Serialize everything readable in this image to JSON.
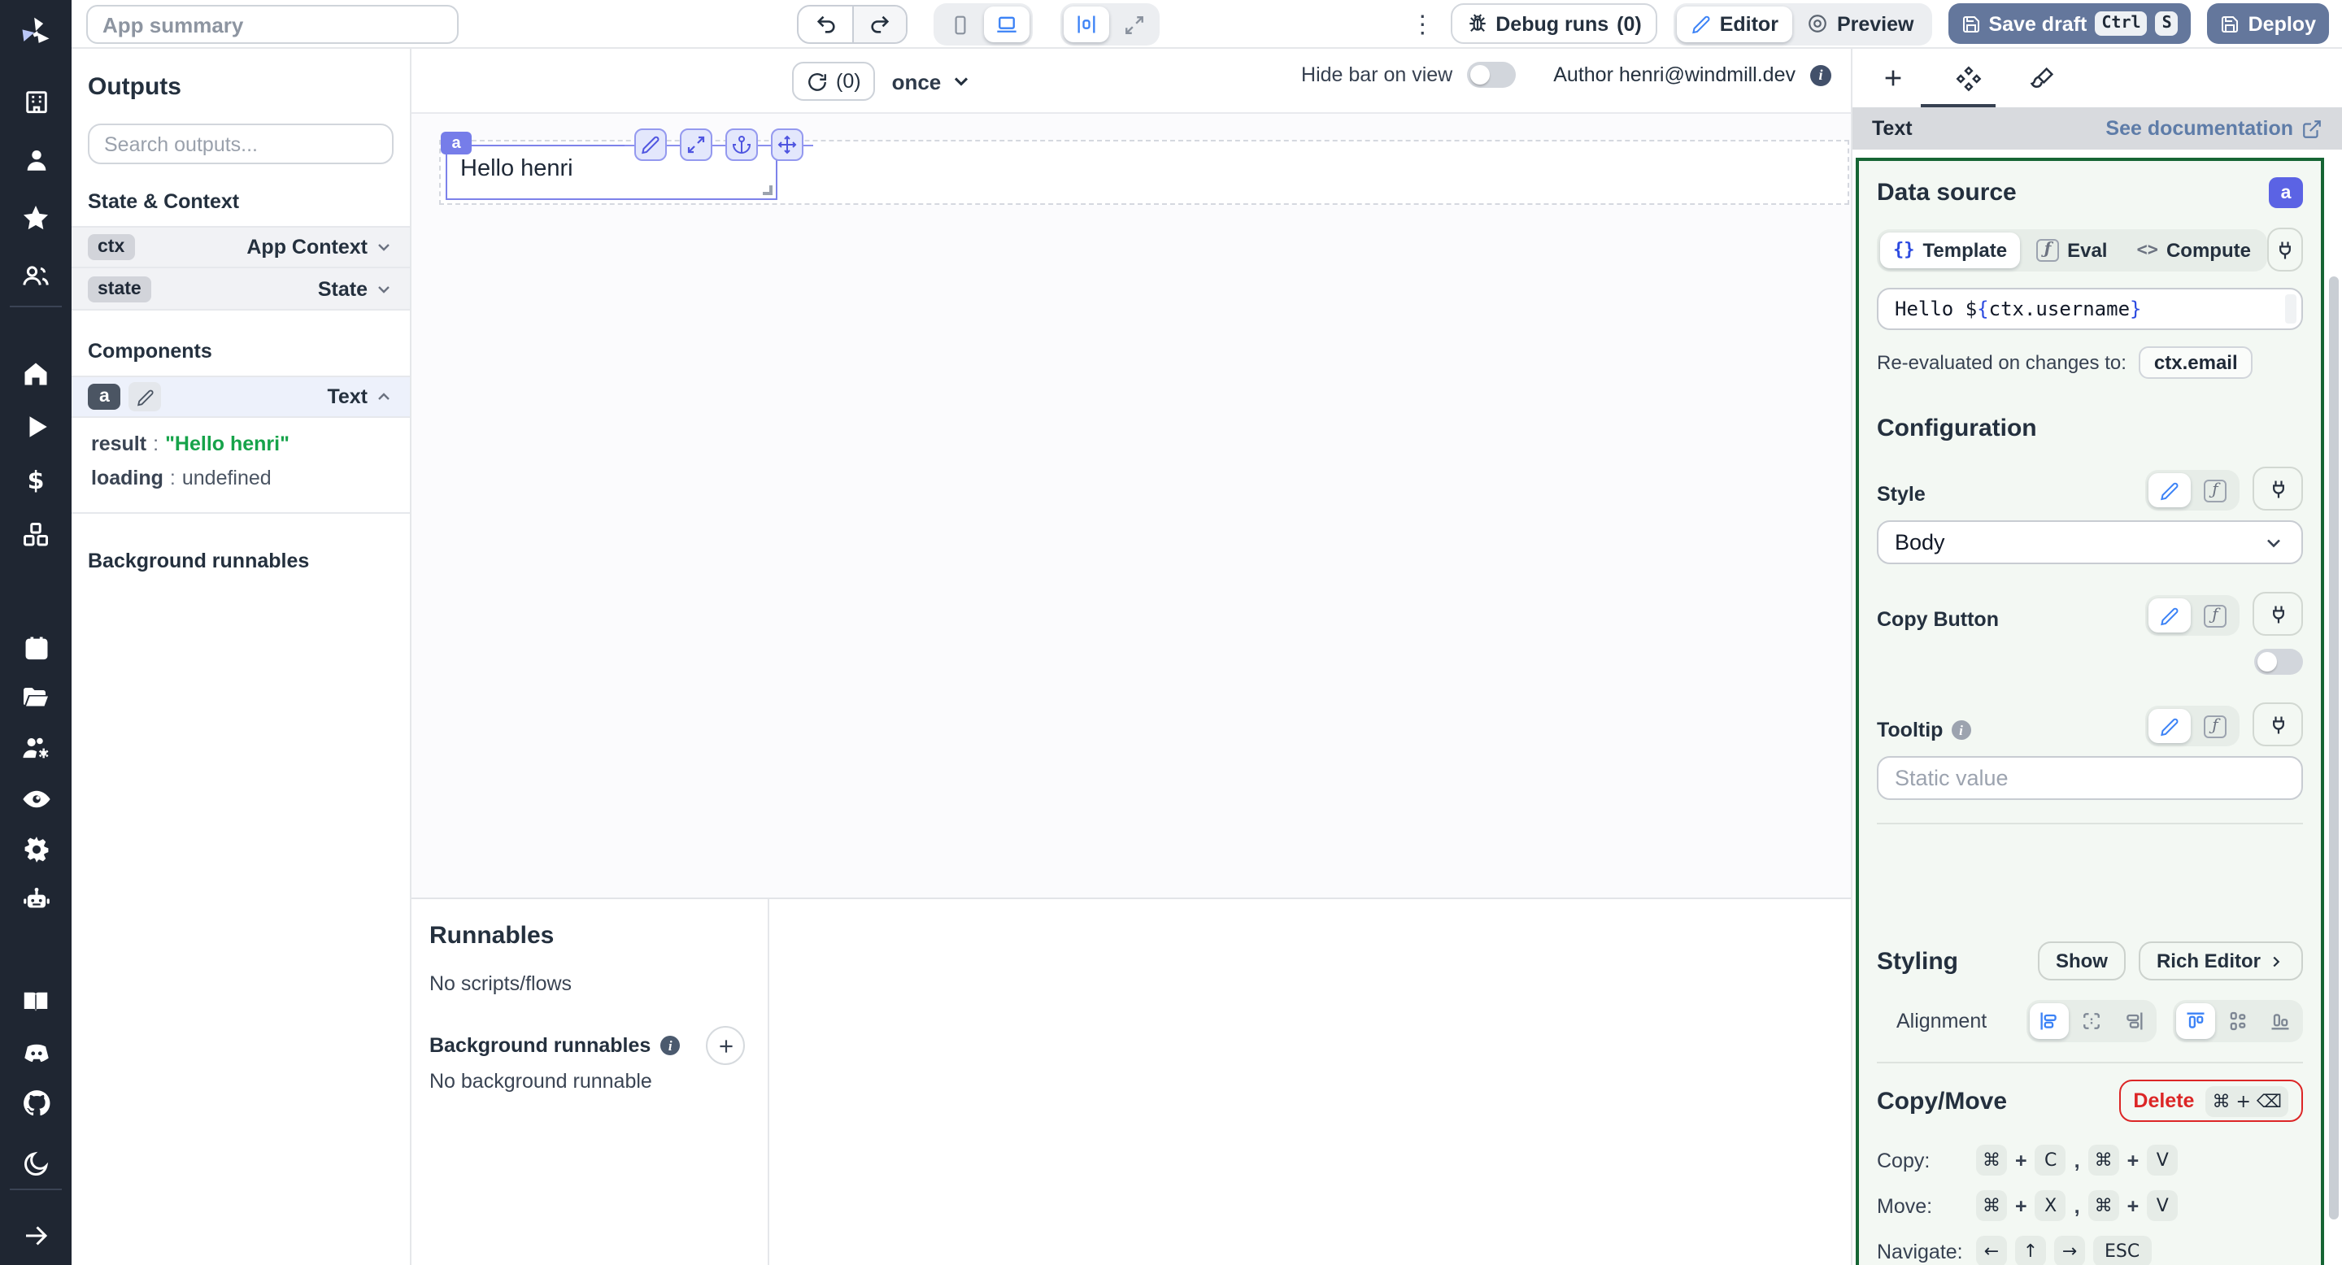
{
  "colors": {
    "sidebar_dark": "#1f2632",
    "accent_blue": "#3b82f6",
    "indigo_badge": "#767de9",
    "settings_badge": "#5b63e4",
    "green_border": "#166534",
    "panel_green_bg": "#f3f8f3",
    "slate_button": "#64779c",
    "delete_red": "#dc2626",
    "result_green": "#16a34a"
  },
  "topbar": {
    "app_summary_placeholder": "App summary",
    "debug_runs_label": "Debug runs",
    "debug_runs_count": "(0)",
    "editor_label": "Editor",
    "preview_label": "Preview",
    "save_draft_label": "Save draft",
    "save_kbd_1": "Ctrl",
    "save_kbd_2": "S",
    "deploy_label": "Deploy",
    "menu_icon": "kebab-menu"
  },
  "outputs": {
    "title": "Outputs",
    "search_placeholder": "Search outputs...",
    "state_context_title": "State & Context",
    "rows": [
      {
        "key": "ctx",
        "type": "App Context"
      },
      {
        "key": "state",
        "type": "State"
      }
    ],
    "components_title": "Components",
    "component": {
      "id": "a",
      "type": "Text",
      "result_key": "result",
      "colon": ":",
      "result_value": "\"Hello henri\"",
      "loading_key": "loading",
      "loading_value": "undefined"
    },
    "background_title": "Background runnables"
  },
  "canvas": {
    "refresh_count": "(0)",
    "recompute_mode": "once",
    "hide_bar_label": "Hide bar on view",
    "author_label": "Author henri@windmill.dev",
    "info_glyph": "i",
    "component": {
      "badge": "a",
      "text": "Hello henri"
    }
  },
  "runnables": {
    "title": "Runnables",
    "empty_scripts": "No scripts/flows",
    "background_title": "Background runnables",
    "background_empty": "No background runnable"
  },
  "settings": {
    "component_type": "Text",
    "doc_link": "See documentation",
    "data_source_title": "Data source",
    "badge": "a",
    "modes": {
      "template_sym": "{}",
      "template": "Template",
      "eval_sym": "ƒ",
      "eval": "Eval",
      "compute_sym": "<>",
      "compute": "Compute"
    },
    "code": {
      "prefix": "Hello $",
      "open": "{",
      "expr": "ctx.username",
      "close": "}"
    },
    "reeval_label": "Re-evaluated on changes to:",
    "reeval_dep": "ctx.email",
    "configuration_title": "Configuration",
    "style_label": "Style",
    "style_value": "Body",
    "copy_button_label": "Copy Button",
    "tooltip_label": "Tooltip",
    "tooltip_info_glyph": "i",
    "tooltip_placeholder": "Static value",
    "styling_title": "Styling",
    "show_label": "Show",
    "rich_editor_label": "Rich Editor",
    "alignment_label": "Alignment",
    "copy_move_title": "Copy/Move",
    "delete_label": "Delete",
    "delete_kbd": "⌘ + ⌫",
    "copy_label": "Copy:",
    "move_label": "Move:",
    "navigate_label": "Navigate:",
    "keys": {
      "cmd": "⌘",
      "plus": "+",
      "c": "C",
      "v": "V",
      "x": "X",
      "comma": ",",
      "left": "←",
      "up": "↑",
      "right": "→",
      "esc": "ESC"
    }
  }
}
